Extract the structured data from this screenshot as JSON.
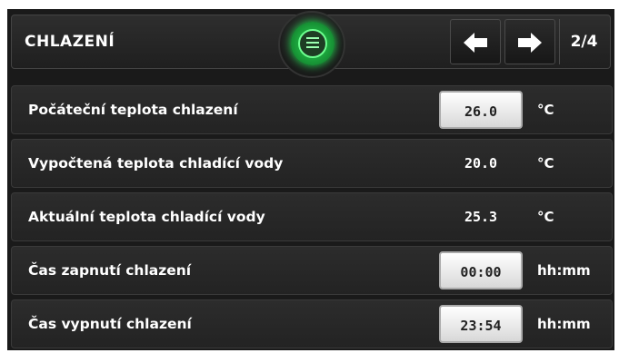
{
  "header": {
    "title": "CHLAZENÍ",
    "page_indicator": "2/4",
    "back_icon": "arrow-left-icon",
    "forward_icon": "arrow-right-icon",
    "menu_icon": "menu-icon"
  },
  "colors": {
    "menu_accent": "#1bd84a",
    "background": "#1a1a1a"
  },
  "rows": [
    {
      "label": "Počáteční teplota chlazení",
      "value": "26.0",
      "unit": "°C",
      "editable": true
    },
    {
      "label": "Vypočtená teplota chladící vody",
      "value": "20.0",
      "unit": "°C",
      "editable": false
    },
    {
      "label": "Aktuální teplota chladící vody",
      "value": "25.3",
      "unit": "°C",
      "editable": false
    },
    {
      "label": "Čas zapnutí chlazení",
      "value": "00:00",
      "unit": "hh:mm",
      "editable": true
    },
    {
      "label": "Čas vypnutí chlazení",
      "value": "23:54",
      "unit": "hh:mm",
      "editable": true
    }
  ]
}
